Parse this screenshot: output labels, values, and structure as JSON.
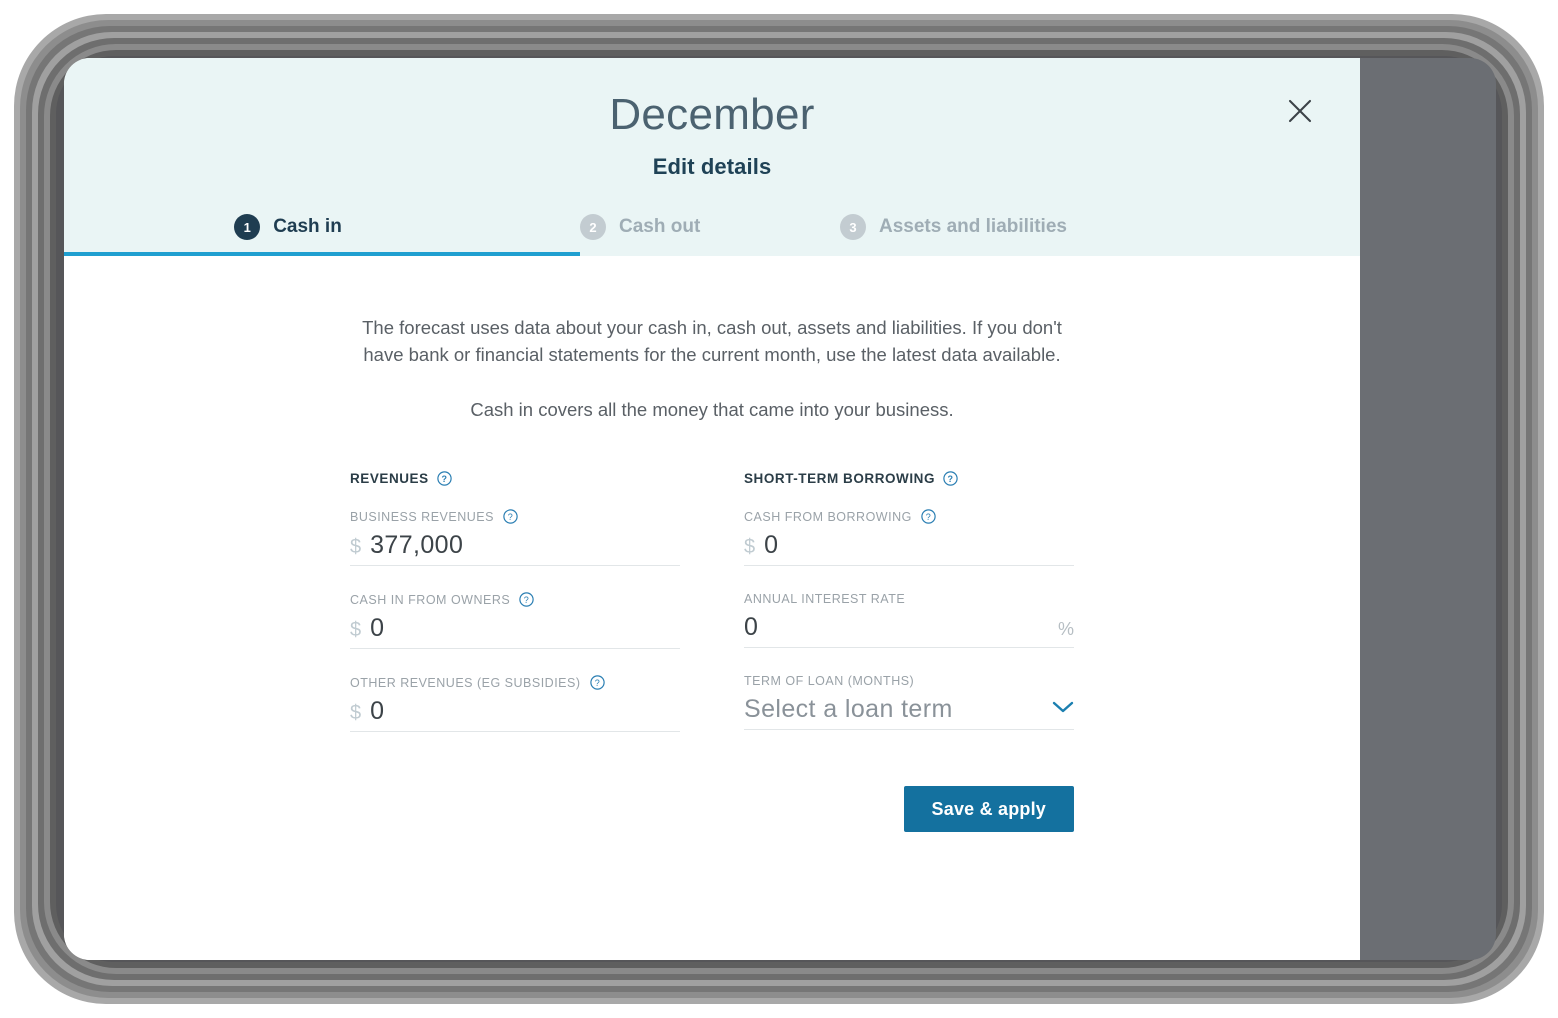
{
  "dialog": {
    "month_title": "December",
    "subtitle": "Edit details",
    "close_icon": "close-icon"
  },
  "tabs": [
    {
      "number": "1",
      "label": "Cash in",
      "state": "active"
    },
    {
      "number": "2",
      "label": "Cash out",
      "state": "inactive"
    },
    {
      "number": "3",
      "label": "Assets and liabilities",
      "state": "inactive"
    }
  ],
  "intro": {
    "paragraph1": "The forecast uses data about your cash in, cash out, assets and liabilities. If you don't have bank or financial statements for the current month, use the latest data available.",
    "paragraph2": "Cash in covers all the money that came into your business."
  },
  "form": {
    "left_section": {
      "heading": "REVENUES",
      "heading_help": "help-icon",
      "fields": [
        {
          "label": "BUSINESS REVENUES",
          "help": "help-icon",
          "prefix": "$",
          "value": "377,000",
          "suffix": ""
        },
        {
          "label": "CASH IN FROM OWNERS",
          "help": "help-icon",
          "prefix": "$",
          "value": "0",
          "suffix": ""
        },
        {
          "label": "OTHER REVENUES (EG SUBSIDIES)",
          "help": "help-icon",
          "prefix": "$",
          "value": "0",
          "suffix": ""
        }
      ]
    },
    "right_section": {
      "heading": "SHORT-TERM BORROWING",
      "heading_help": "help-icon",
      "fields": [
        {
          "label": "CASH FROM BORROWING",
          "help": "help-icon",
          "prefix": "$",
          "value": "0",
          "suffix": ""
        },
        {
          "label": "ANNUAL INTEREST RATE",
          "help": "",
          "prefix": "",
          "value": "0",
          "suffix": "%"
        },
        {
          "label": "TERM OF LOAN (MONTHS)",
          "help": "",
          "prefix": "",
          "value": "Select a loan term",
          "suffix": "chevron-down-icon"
        }
      ]
    }
  },
  "actions": {
    "save_label": "Save & apply"
  },
  "colors": {
    "header_bg": "#eaf5f5",
    "accent_underline": "#1f9fd0",
    "primary_button": "#14719f",
    "badge_active": "#1f3d51",
    "badge_inactive": "#c3ccd1",
    "help_icon": "#2b7fb3",
    "screen_bg": "#6b6e73"
  }
}
